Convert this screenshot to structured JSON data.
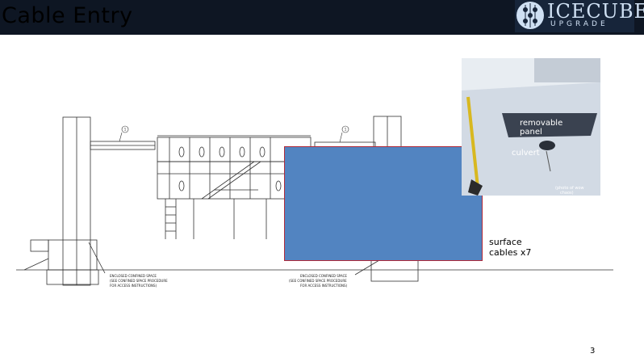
{
  "slide": {
    "title": "Cable Entry",
    "page_number": "3"
  },
  "logo": {
    "name": "ICECUBE",
    "sub": "UPGRADE"
  },
  "drawing": {
    "callout_1": "1",
    "callout_2": "1",
    "note_left": [
      "ENCLOSED CONFINED SPACE",
      "(SEE CONFINED SPACE PROCEDURE",
      "FOR ACCESS INSTRUCTIONS)"
    ],
    "note_right": [
      "ENCLOSED CONFINED SPACE",
      "(SEE CONFINED SPACE PROCEDURE",
      "FOR ACCESS INSTRUCTIONS)"
    ]
  },
  "photo": {
    "label_panel_line1": "removable",
    "label_panel_line2": "panel",
    "label_culvert": "culvert",
    "credit_line1": "(photo of wow",
    "credit_line2": "chaos)"
  },
  "surface_label": {
    "line1": "surface",
    "line2": "cables x7"
  },
  "colors": {
    "header_bg": "#0e1623",
    "blue_box": "#5284c1",
    "blue_box_border": "#b02a3a"
  }
}
